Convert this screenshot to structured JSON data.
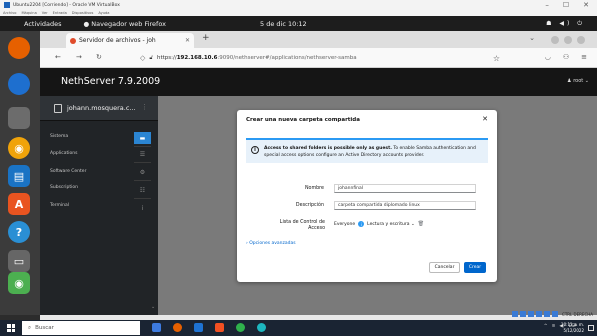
{
  "vbox": {
    "title": "Ubuntu2204 [Corriendo] - Oracle VM VirtualBox",
    "menu": [
      "Archivo",
      "Máquina",
      "Ver",
      "Entrada",
      "Dispositivos",
      "Ayuda"
    ],
    "controls": [
      "–",
      "☐",
      "✕"
    ]
  },
  "gnome": {
    "activities": "Actividades",
    "app_name": "Navegador web Firefox",
    "clock": "5 de dic 10:12",
    "tray": "☗ ◀) ⏻"
  },
  "browser": {
    "tab_title": "Servidor de archivos - joh",
    "tab_close": "✕",
    "new_tab": "+",
    "url_host": "192.168.10.6",
    "url_prefix": "https://",
    "url_path": ":9090/nethserver#/applications/nethserver-samba"
  },
  "nethserver": {
    "brand": "NethServer 7.9.2009",
    "user": "root",
    "host": "johann.mosquera.c...",
    "nav": [
      "Sistema",
      "Applications",
      "Software Center",
      "Subscription",
      "Terminal"
    ]
  },
  "dialog": {
    "title": "Crear una nueva carpeta compartida",
    "close": "✕",
    "alert_bold": "Access to shared folders is possible only as guest.",
    "alert_rest": " To enable Samba authentication and special access options configure an Active Directory accounts provider.",
    "name_label": "Nombre",
    "name_value": "johannfinal",
    "desc_label": "Descripción",
    "desc_value": "carpeta compartida diplomado linux",
    "acl_label": "Lista de Control de Acceso",
    "acl_who": "Everyone",
    "acl_perm": "Lectura y escritura",
    "advanced": "Opciones avanzadas",
    "cancel": "Cancelar",
    "create": "Crear"
  },
  "taskbar": {
    "search_placeholder": "Buscar",
    "time": "10:11 a. m.",
    "date": "5/12/2022",
    "lang": "ESP",
    "ctrl": "CTRL DERECHA"
  }
}
